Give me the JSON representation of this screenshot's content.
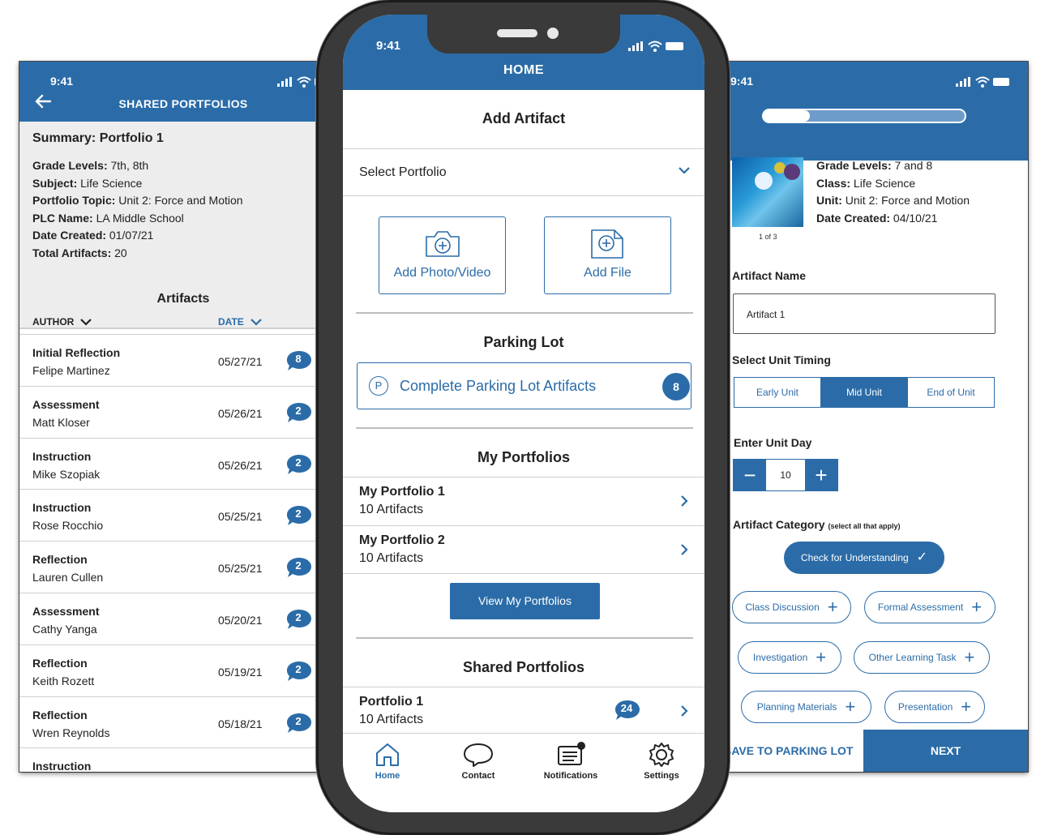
{
  "left_screen": {
    "time": "9:41",
    "title": "SHARED PORTFOLIOS",
    "summary": {
      "heading": "Summary: Portfolio 1",
      "rows": [
        {
          "label": "Grade Levels:",
          "value": " 7th, 8th"
        },
        {
          "label": "Subject:",
          "value": " Life Science"
        },
        {
          "label": "Portfolio Topic:",
          "value": " Unit 2: Force and Motion"
        },
        {
          "label": "PLC Name:",
          "value": " LA Middle School"
        },
        {
          "label": "Date Created:",
          "value": " 01/07/21"
        },
        {
          "label": "Total Artifacts:",
          "value": " 20"
        }
      ]
    },
    "artifacts_title": "Artifacts",
    "col_author": "AUTHOR",
    "col_date": "DATE",
    "artifacts": [
      {
        "type": "Initial Reflection",
        "author": "Felipe Martinez",
        "date": "05/27/21",
        "count": "8"
      },
      {
        "type": "Assessment",
        "author": "Matt Kloser",
        "date": "05/26/21",
        "count": "2"
      },
      {
        "type": "Instruction",
        "author": "Mike Szopiak",
        "date": "05/26/21",
        "count": "2"
      },
      {
        "type": "Instruction",
        "author": "Rose Rocchio",
        "date": "05/25/21",
        "count": "2"
      },
      {
        "type": "Reflection",
        "author": "Lauren Cullen",
        "date": "05/25/21",
        "count": "2"
      },
      {
        "type": "Assessment",
        "author": "Cathy Yanga",
        "date": "05/20/21",
        "count": "2"
      },
      {
        "type": "Reflection",
        "author": "Keith Rozett",
        "date": "05/19/21",
        "count": "2"
      },
      {
        "type": "Reflection",
        "author": "Wren Reynolds",
        "date": "05/18/21",
        "count": "2"
      },
      {
        "type": "Instruction",
        "author": "",
        "date": "",
        "count": ""
      }
    ]
  },
  "center_screen": {
    "time": "9:41",
    "title": "HOME",
    "add_artifact_title": "Add Artifact",
    "select_portfolio": "Select Portfolio",
    "add_photo_label": "Add Photo/Video",
    "add_file_label": "Add File",
    "parking_lot_title": "Parking Lot",
    "parking_lot_button": "Complete Parking Lot Artifacts",
    "parking_lot_count": "8",
    "my_portfolios_title": "My Portfolios",
    "my_portfolios": [
      {
        "name": "My Portfolio 1",
        "count": "10 Artifacts"
      },
      {
        "name": "My Portfolio 2",
        "count": "10 Artifacts"
      }
    ],
    "view_button": "View My Portfolios",
    "shared_portfolios_title": "Shared Portfolios",
    "shared_portfolios": [
      {
        "name": "Portfolio 1",
        "count": "10 Artifacts",
        "badge": "24"
      }
    ],
    "tabs": [
      {
        "label": "Home",
        "icon": "home-icon"
      },
      {
        "label": "Contact",
        "icon": "chat-icon"
      },
      {
        "label": "Notifications",
        "icon": "notifications-icon"
      },
      {
        "label": "Settings",
        "icon": "gear-icon"
      }
    ]
  },
  "right_screen": {
    "time": "9:41",
    "progress": 0.23,
    "thumb_caption": "1 of 3",
    "meta": [
      {
        "label": "Grade Levels:",
        "value": " 7 and 8"
      },
      {
        "label": "Class:",
        "value": " Life Science"
      },
      {
        "label": "Unit:",
        "value": " Unit 2: Force and Motion"
      },
      {
        "label": "Date Created:",
        "value": " 04/10/21"
      }
    ],
    "artifact_name_label": "Artifact Name",
    "artifact_name_value": "Artifact 1",
    "unit_timing_label": "Select Unit Timing",
    "unit_timing_options": [
      "Early Unit",
      "Mid Unit",
      "End of Unit"
    ],
    "unit_timing_selected": "Mid Unit",
    "unit_day_label": "Enter Unit Day",
    "unit_day_value": "10",
    "category_label": "Artifact Category",
    "category_hint": "(select all that apply)",
    "categories": [
      {
        "label": "Check for Understanding",
        "selected": true
      },
      {
        "label": "Class Discussion",
        "selected": false
      },
      {
        "label": "Formal Assessment",
        "selected": false
      },
      {
        "label": "Investigation",
        "selected": false
      },
      {
        "label": "Other Learning Task",
        "selected": false
      },
      {
        "label": "Planning Materials",
        "selected": false
      },
      {
        "label": "Presentation",
        "selected": false
      }
    ],
    "save_button": "SAVE TO PARKING LOT",
    "next_button": "NEXT"
  },
  "colors": {
    "brand_blue": "#2b6ca8",
    "frame": "#3a3a3a"
  }
}
